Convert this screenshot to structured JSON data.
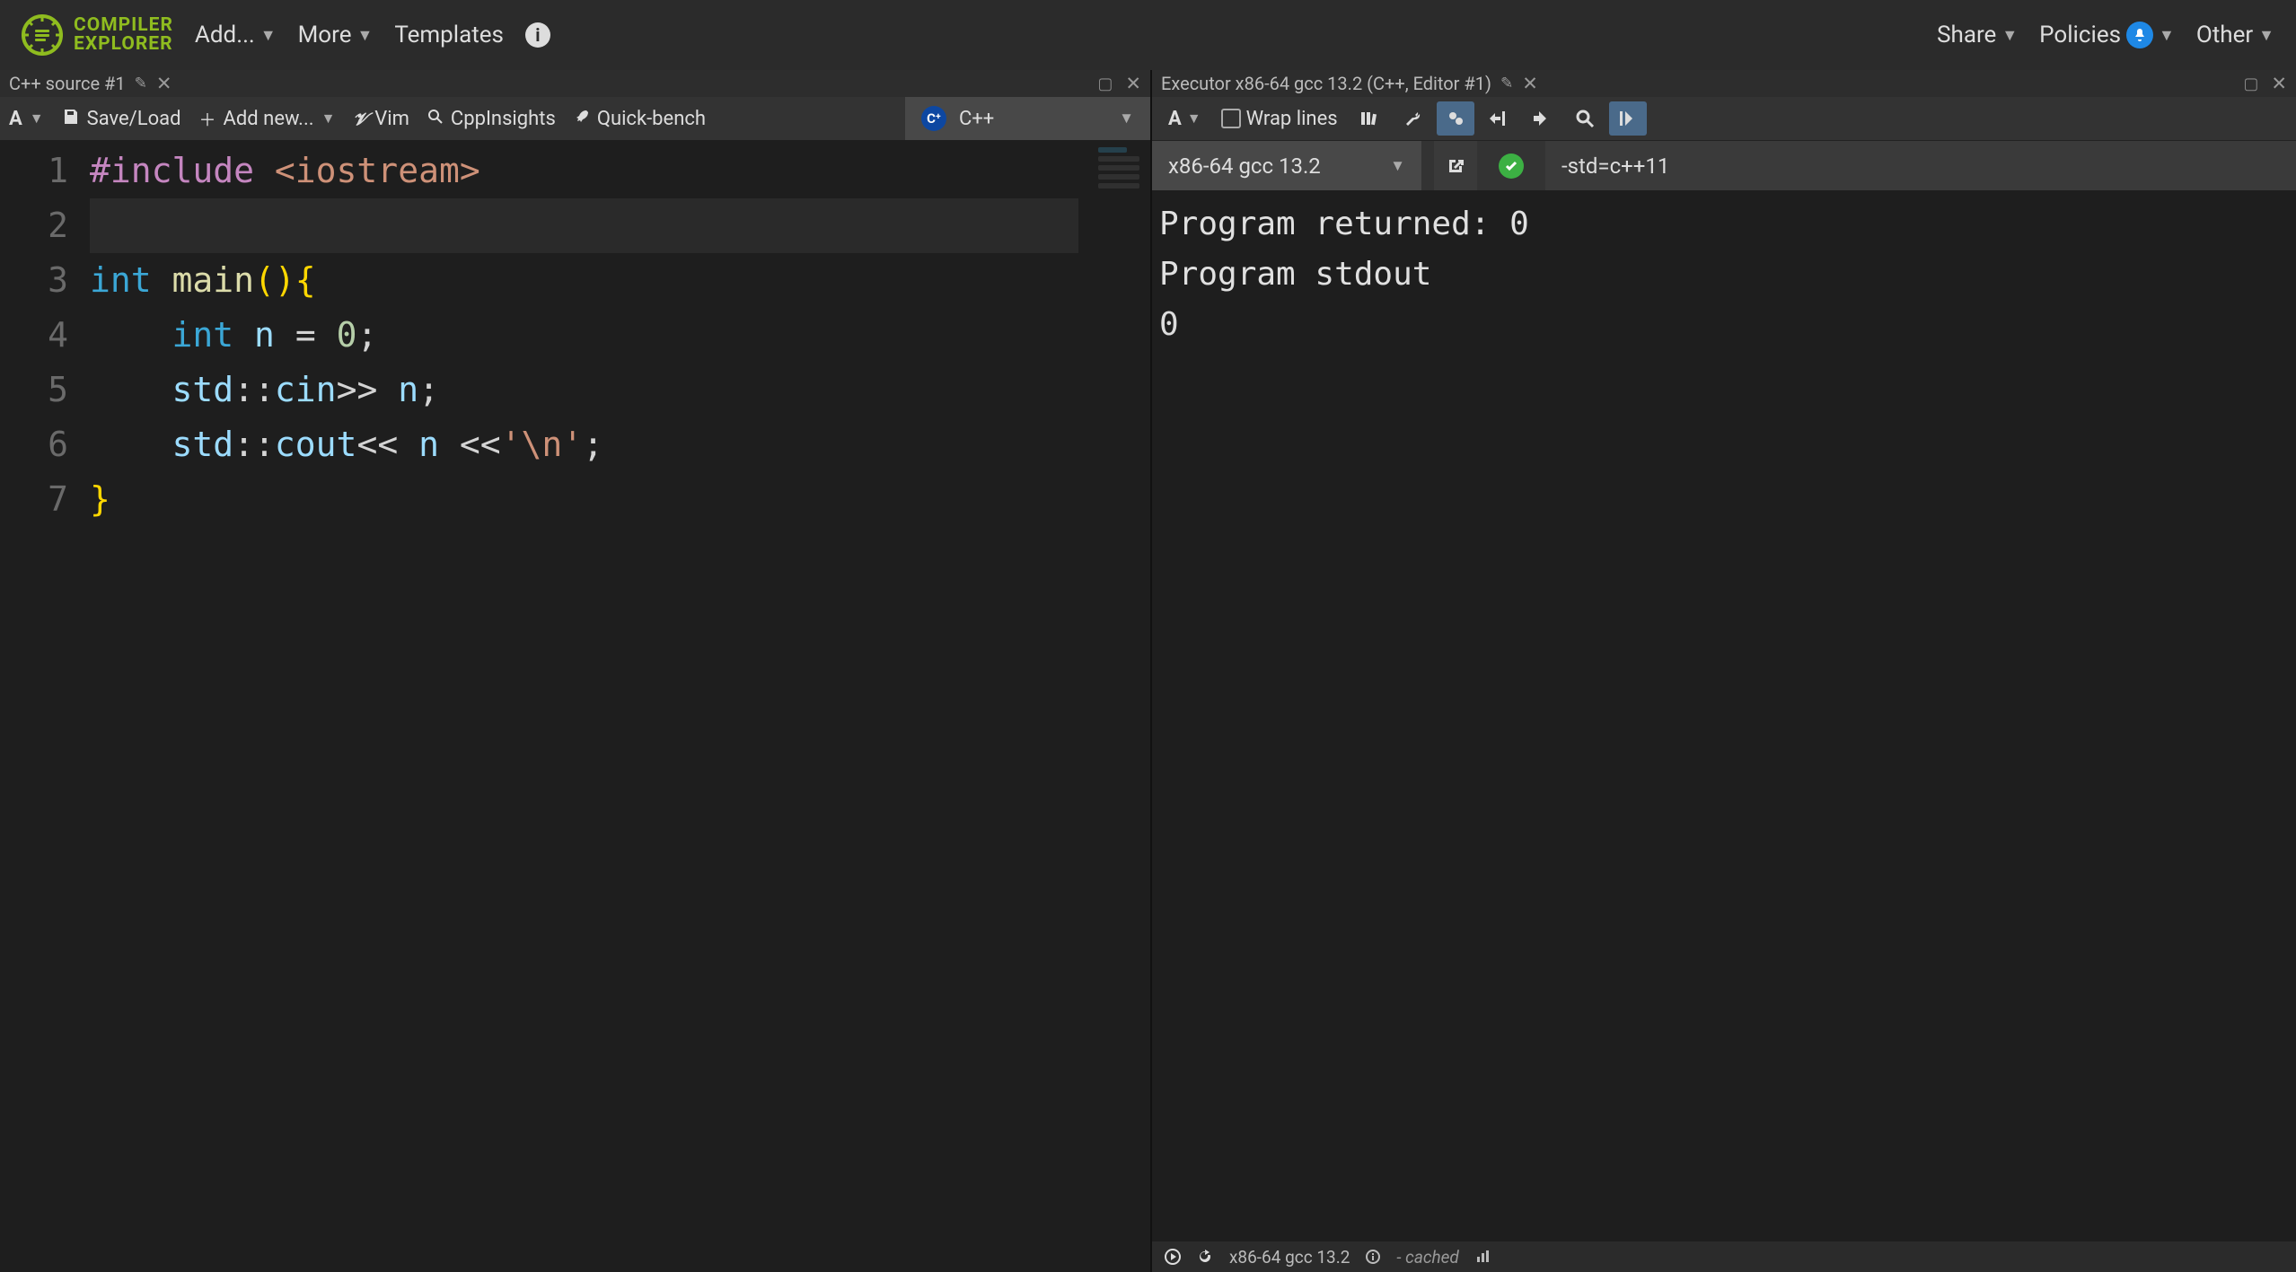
{
  "brand": {
    "line1": "COMPILER",
    "line2": "EXPLORER"
  },
  "nav": {
    "add": "Add...",
    "more": "More",
    "templates": "Templates",
    "share": "Share",
    "policies": "Policies",
    "other": "Other"
  },
  "left": {
    "tab_title": "C++ source #1",
    "toolbar": {
      "saveload": "Save/Load",
      "addnew": "Add new...",
      "vim": "Vim",
      "cppinsights": "CppInsights",
      "quickbench": "Quick-bench"
    },
    "language": "C++",
    "code_lines": [
      "1",
      "2",
      "3",
      "4",
      "5",
      "6",
      "7"
    ]
  },
  "code": {
    "l1_include": "#include",
    "l1_header": "<iostream>",
    "l3_int": "int",
    "l3_main": "main",
    "l3_paren": "(){",
    "l4_int": "int",
    "l4_var": "n",
    "l4_eq": " = ",
    "l4_zero": "0",
    "l4_semi": ";",
    "l5_std": "std",
    "l5_cin": "cin",
    "l5_op": ">>",
    "l5_n": "n",
    "l5_semi": ";",
    "l6_std": "std",
    "l6_cout": "cout",
    "l6_op1": "<<",
    "l6_n": "n",
    "l6_op2": "<<",
    "l6_nl": "'\\n'",
    "l6_semi": ";",
    "l7_brace": "}"
  },
  "right": {
    "tab_title": "Executor x86-64 gcc 13.2 (C++, Editor #1)",
    "wrap_label": "Wrap lines",
    "compiler": "x86-64 gcc 13.2",
    "flags": "-std=c++11",
    "output": {
      "returned": "Program returned: 0",
      "stdout_hdr": "Program stdout",
      "line1": "0"
    },
    "status": {
      "compiler": "x86-64 gcc 13.2",
      "cached": "- cached"
    }
  }
}
